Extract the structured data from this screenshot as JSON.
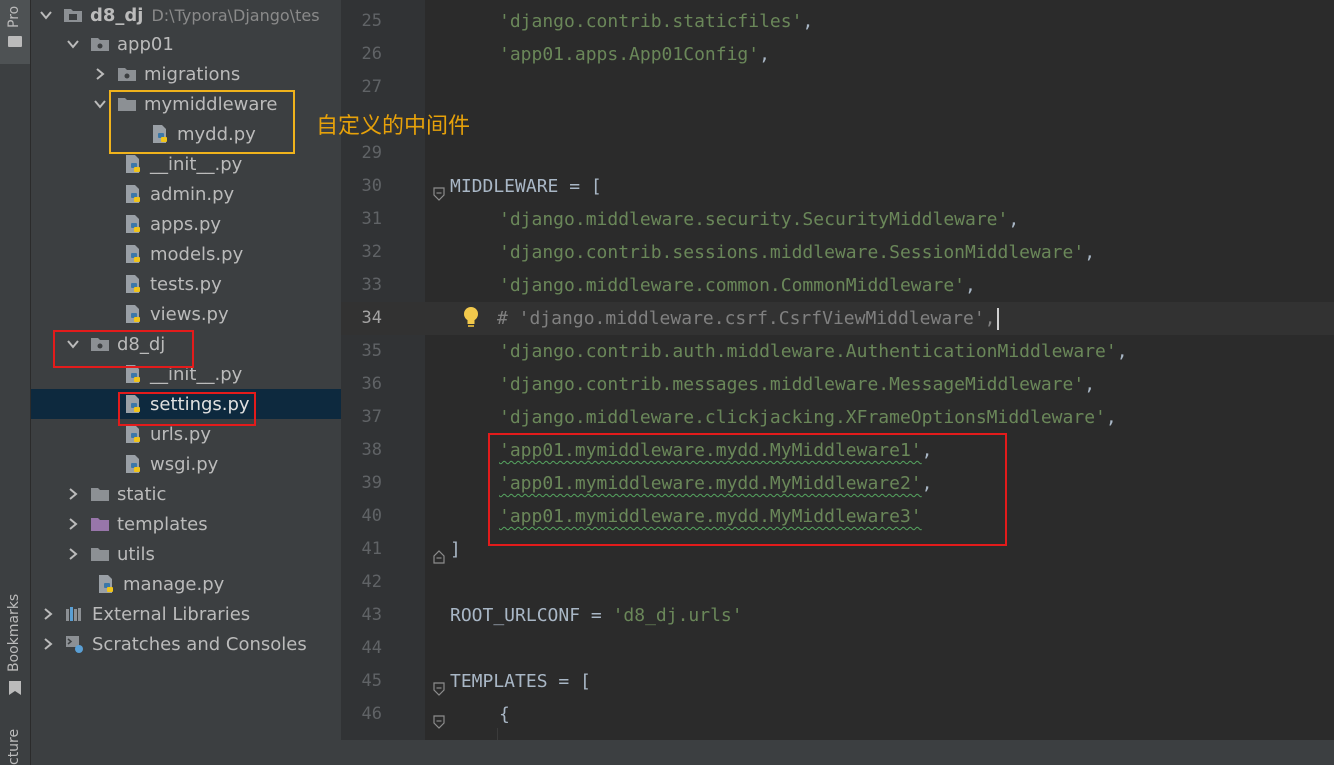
{
  "colors": {
    "highlight_yellow": "#f0b31c",
    "highlight_red": "#e31b1b",
    "annotation_text": "#e6a10a",
    "string": "#6a8759"
  },
  "left_strip": {
    "project_tab": "Pro",
    "bookmarks_tab": "Bookmarks",
    "structure_tab": "cture"
  },
  "tree": {
    "root": {
      "label": "d8_dj",
      "path": "D:\\Typora\\Django\\tes"
    },
    "app01": "app01",
    "migrations": "migrations",
    "mymiddleware": "mymiddleware",
    "mydd": "mydd.py",
    "app01_init": "__init__.py",
    "admin": "admin.py",
    "apps": "apps.py",
    "models": "models.py",
    "tests": "tests.py",
    "views": "views.py",
    "d8_dj": "d8_dj",
    "d8_init": "__init__.py",
    "settings": "settings.py",
    "urls": "urls.py",
    "wsgi": "wsgi.py",
    "static": "static",
    "templates": "templates",
    "utils": "utils",
    "manage": "manage.py",
    "external": "External Libraries",
    "scratches": "Scratches and Consoles"
  },
  "annotation": "自定义的中间件",
  "editor": {
    "lines": [
      {
        "n": "25",
        "text": "'django.contrib.staticfiles'"
      },
      {
        "n": "26",
        "text": "'app01.apps.App01Config'"
      },
      {
        "n": "27",
        "text": ""
      },
      {
        "n": "28",
        "text": ""
      },
      {
        "n": "29",
        "text": ""
      },
      {
        "n": "30",
        "text": "MIDDLEWARE = ["
      },
      {
        "n": "31",
        "text": "'django.middleware.security.SecurityMiddleware'"
      },
      {
        "n": "32",
        "text": "'django.contrib.sessions.middleware.SessionMiddleware'"
      },
      {
        "n": "33",
        "text": "'django.middleware.common.CommonMiddleware'"
      },
      {
        "n": "34",
        "text": "# 'django.middleware.csrf.CsrfViewMiddleware',"
      },
      {
        "n": "35",
        "text": "'django.contrib.auth.middleware.AuthenticationMiddleware'"
      },
      {
        "n": "36",
        "text": "'django.contrib.messages.middleware.MessageMiddleware'"
      },
      {
        "n": "37",
        "text": "'django.middleware.clickjacking.XFrameOptionsMiddleware'"
      },
      {
        "n": "38",
        "text": "'app01.mymiddleware.mydd.MyMiddleware1'"
      },
      {
        "n": "39",
        "text": "'app01.mymiddleware.mydd.MyMiddleware2'"
      },
      {
        "n": "40",
        "text": "'app01.mymiddleware.mydd.MyMiddleware3'"
      },
      {
        "n": "41",
        "text": "]"
      },
      {
        "n": "42",
        "text": ""
      },
      {
        "n": "43",
        "code": "ROOT_URLCONF = ",
        "text": "'d8_dj.urls'"
      },
      {
        "n": "44",
        "text": ""
      },
      {
        "n": "45",
        "text": "TEMPLATES = ["
      },
      {
        "n": "46",
        "text": "{"
      }
    ],
    "comma": ","
  }
}
